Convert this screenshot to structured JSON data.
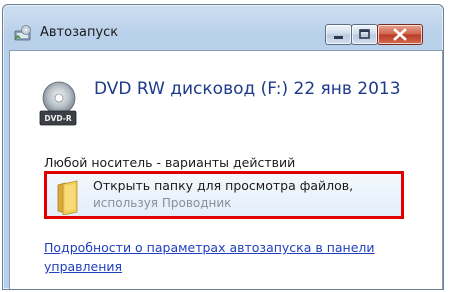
{
  "window": {
    "title": "Автозапуск"
  },
  "drive": {
    "title": "DVD RW дисковод (F:) 22 янв 2013",
    "icon_label": "DVD-R"
  },
  "section": {
    "heading": "Любой носитель - варианты действий"
  },
  "actions": [
    {
      "title": "Открыть папку для просмотра файлов,",
      "subtitle": "используя Проводник",
      "icon": "folder-icon"
    }
  ],
  "footer": {
    "link": "Подробности о параметрах автозапуска в панели управления"
  },
  "colors": {
    "highlight_border": "#e00000",
    "link": "#1f3fbf",
    "drive_title": "#1e3a8a"
  }
}
